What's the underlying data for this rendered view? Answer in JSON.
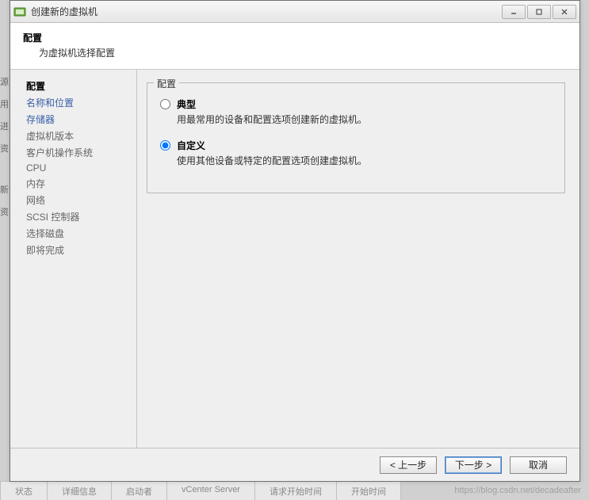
{
  "window": {
    "title": "创建新的虚拟机"
  },
  "header": {
    "title": "配置",
    "subtitle": "为虚拟机选择配置"
  },
  "sidebar": {
    "items": [
      {
        "label": "配置",
        "active": true
      },
      {
        "label": "名称和位置"
      },
      {
        "label": "存储器"
      },
      {
        "label": "虚拟机版本"
      },
      {
        "label": "客户机操作系统"
      },
      {
        "label": "CPU"
      },
      {
        "label": "内存"
      },
      {
        "label": "网络"
      },
      {
        "label": "SCSI 控制器"
      },
      {
        "label": "选择磁盘"
      },
      {
        "label": "即将完成"
      }
    ]
  },
  "group": {
    "title": "配置",
    "options": [
      {
        "label": "典型",
        "desc": "用最常用的设备和配置选项创建新的虚拟机。",
        "checked": false
      },
      {
        "label": "自定义",
        "desc": "使用其他设备或特定的配置选项创建虚拟机。",
        "checked": true
      }
    ]
  },
  "footer": {
    "back": "< 上一步",
    "next": "下一步 >",
    "cancel": "取消"
  },
  "watermark": "https://blog.csdn.net/decadeafter",
  "bgtabs": [
    "状态",
    "详细信息",
    "启动者",
    "vCenter Server",
    "请求开始时间",
    "开始时间"
  ],
  "leftstrip": [
    "源",
    "用",
    "进",
    "资",
    "",
    "",
    "",
    "新",
    "资"
  ]
}
